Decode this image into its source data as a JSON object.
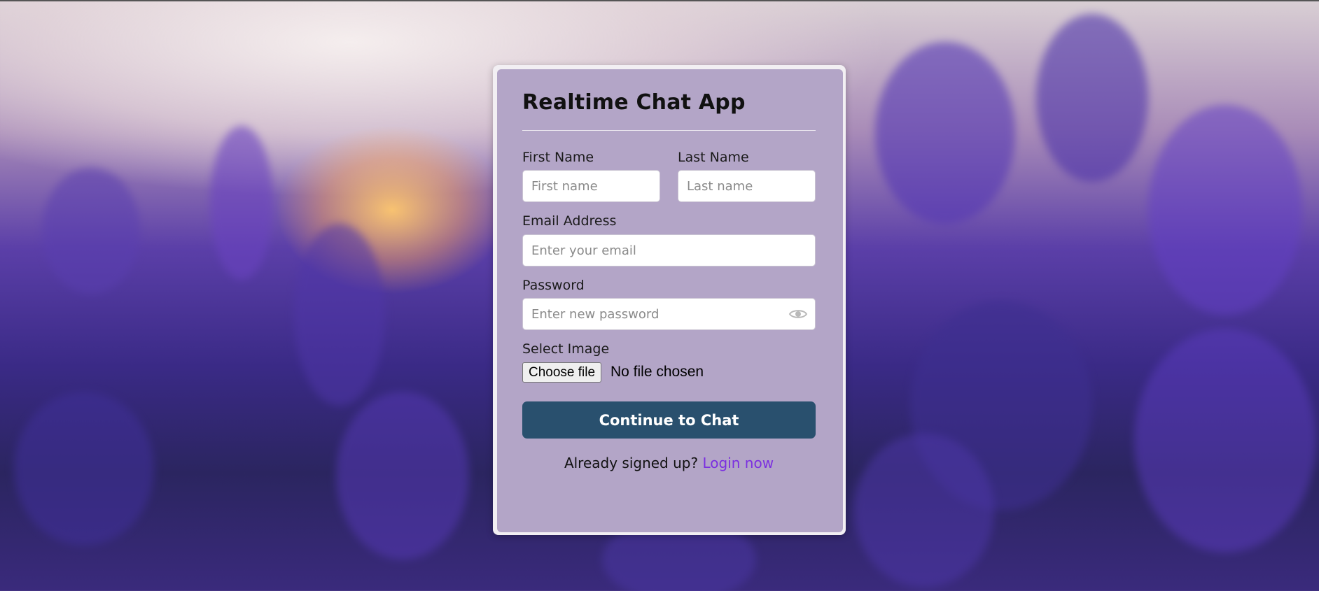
{
  "app": {
    "title": "Realtime Chat App"
  },
  "form": {
    "first_name": {
      "label": "First Name",
      "placeholder": "First name"
    },
    "last_name": {
      "label": "Last Name",
      "placeholder": "Last name"
    },
    "email": {
      "label": "Email Address",
      "placeholder": "Enter your email"
    },
    "password": {
      "label": "Password",
      "placeholder": "Enter new password",
      "toggle_icon": "eye-icon"
    },
    "image": {
      "label": "Select Image",
      "button_label": "Choose file",
      "status": "No file chosen"
    },
    "submit_label": "Continue to Chat"
  },
  "footer": {
    "prompt": "Already signed up?",
    "link_label": "Login now"
  },
  "colors": {
    "card_bg": "#b3a5c7",
    "primary_button": "#29506e",
    "link": "#7b2fe0"
  }
}
